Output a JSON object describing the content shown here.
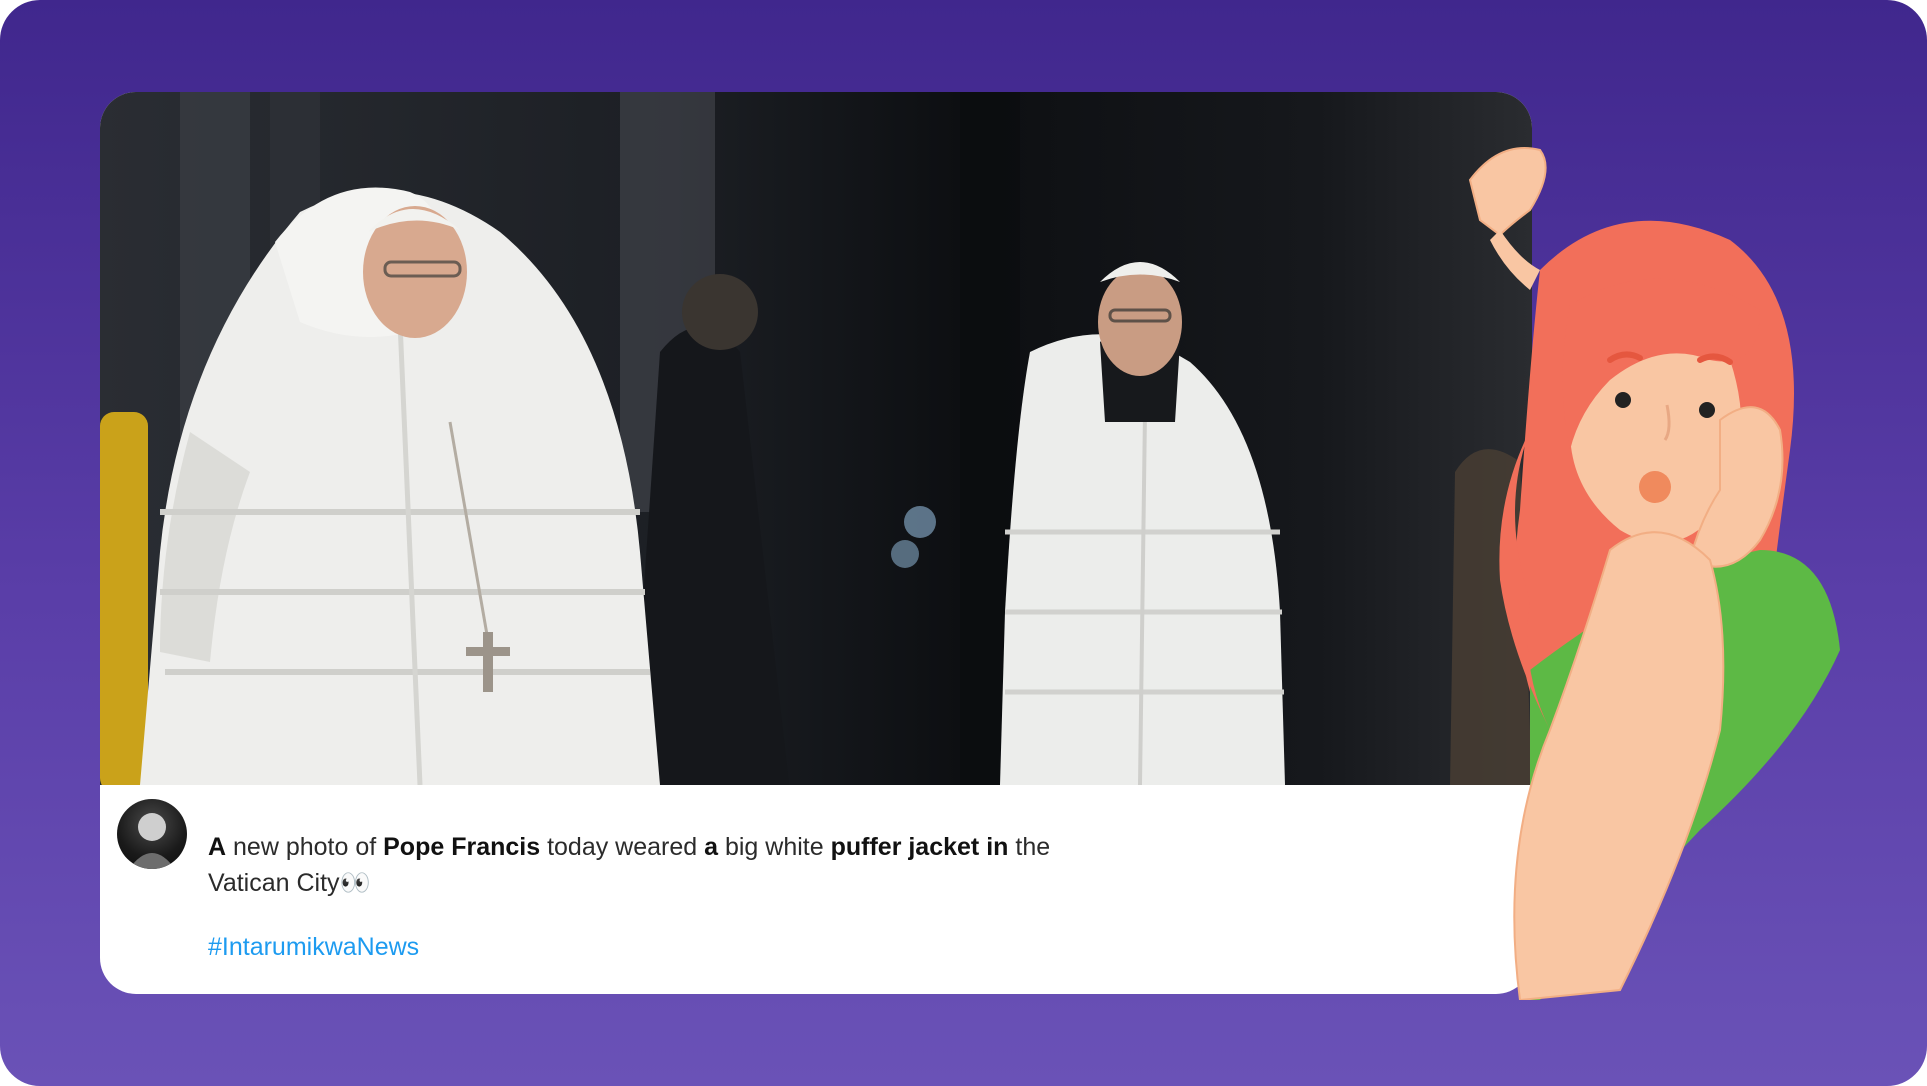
{
  "post": {
    "image_alt": "Two images of Pope Francis wearing a white puffer jacket",
    "text_parts": [
      {
        "text": "A",
        "bold": true
      },
      {
        "text": " new photo of ",
        "bold": false
      },
      {
        "text": "Pope Francis",
        "bold": true
      },
      {
        "text": " today weared ",
        "bold": false
      },
      {
        "text": "a",
        "bold": true
      },
      {
        "text": " big white ",
        "bold": false
      },
      {
        "text": "puffer jacket in",
        "bold": true
      },
      {
        "text": " the",
        "bold": false
      }
    ],
    "text_line2": "Vatican City",
    "emoji": "👀",
    "hashtag": "#IntarumikwaNews"
  },
  "colors": {
    "background_top": "#40278d",
    "background_bottom": "#6a52b7",
    "hashtag": "#1d9bf0",
    "hair": "#f26f5a",
    "shirt": "#5db945",
    "skin": "#f9c6a3"
  },
  "icons": {
    "avatar": "user-avatar",
    "illustration": "surprised-girl-peeking"
  }
}
